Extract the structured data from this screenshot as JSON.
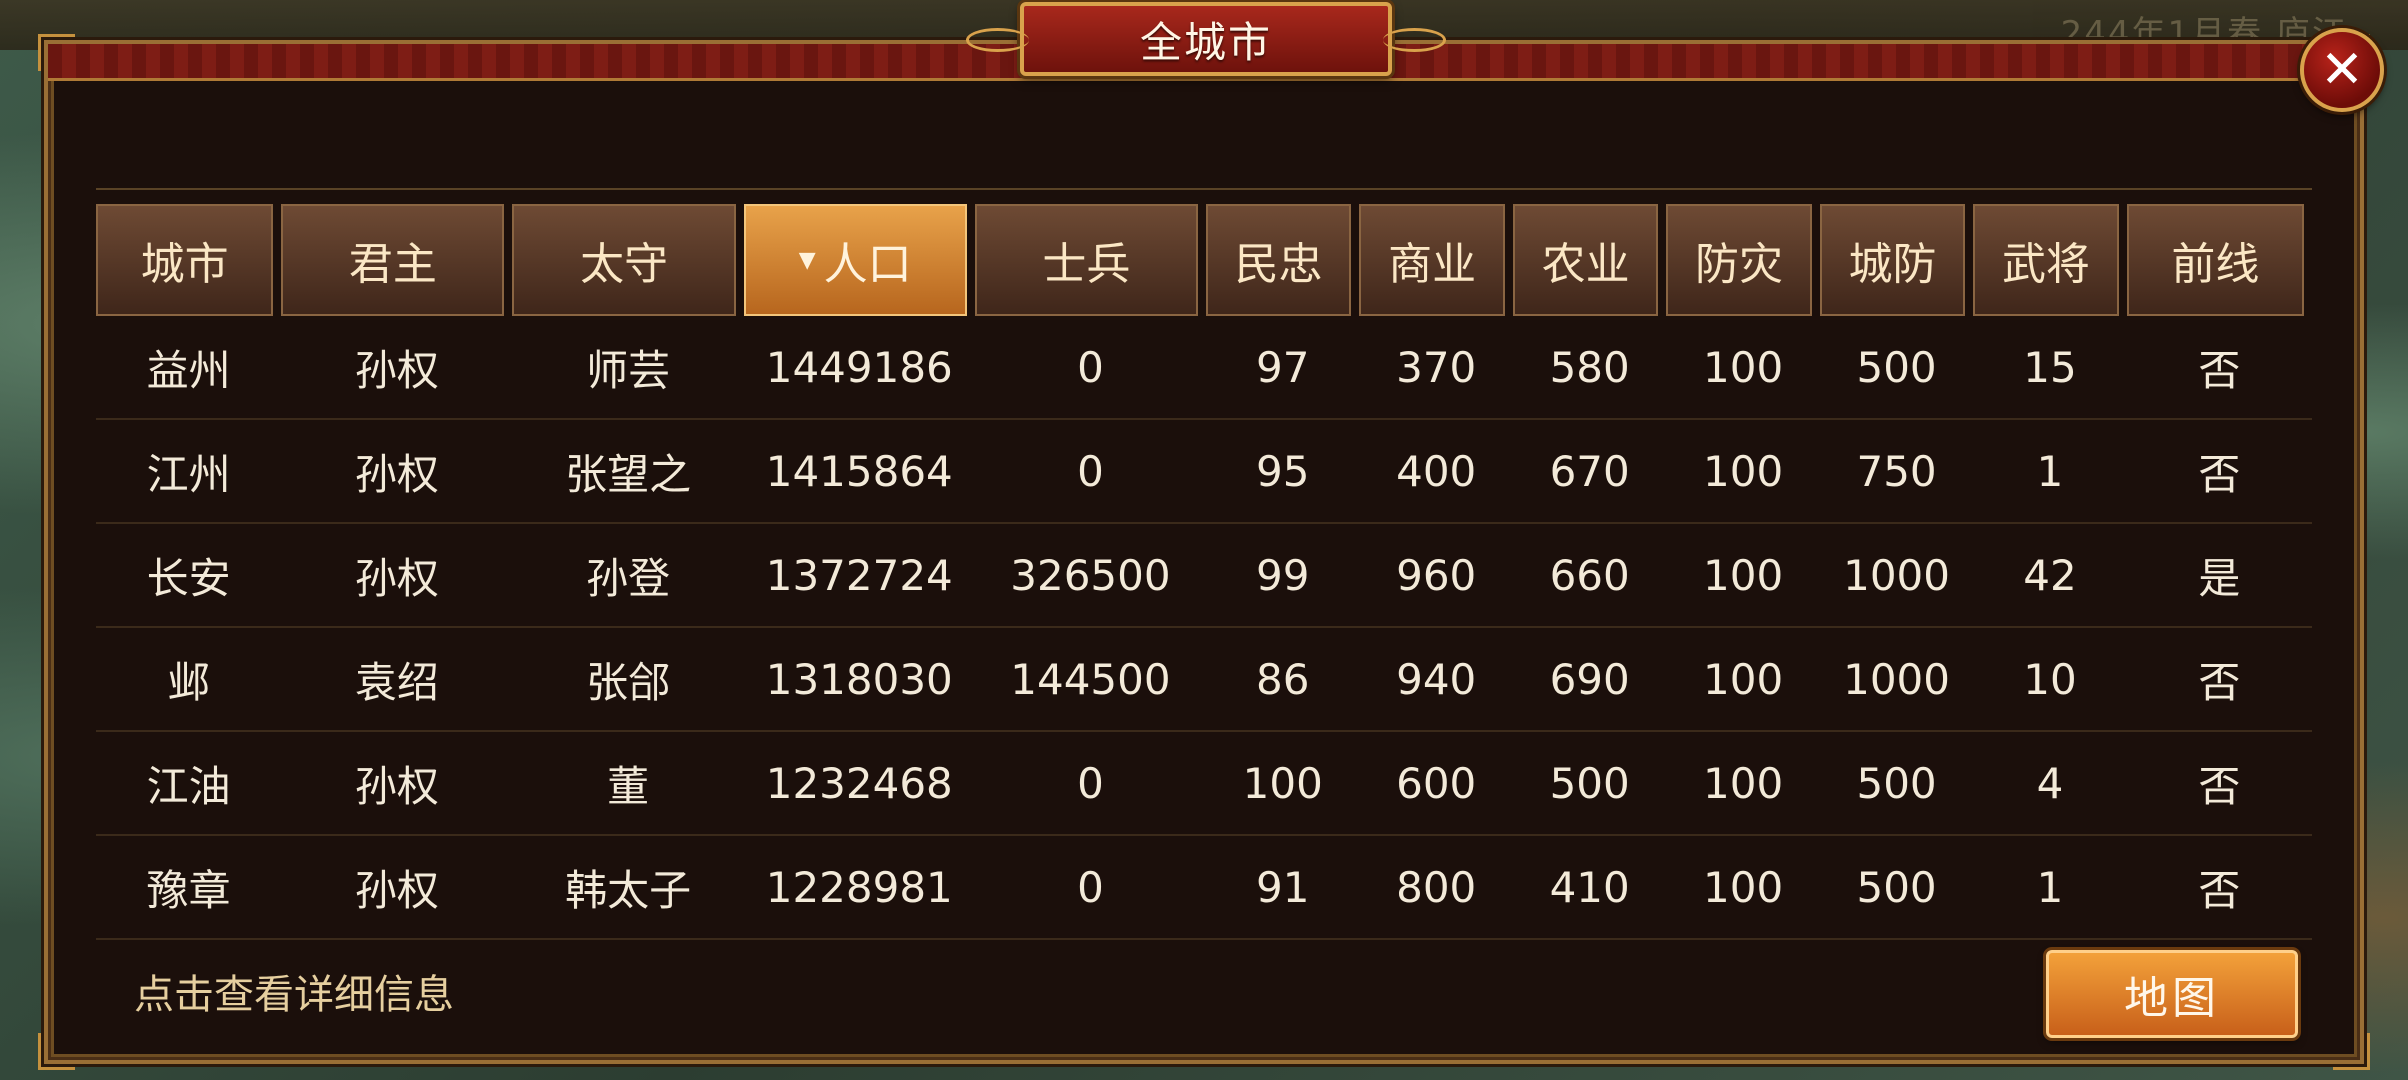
{
  "window": {
    "title": "全城市",
    "close_icon": "close-icon"
  },
  "background": {
    "top_right_text": "244年1月春 庐江"
  },
  "table": {
    "headers": [
      {
        "label": "城市",
        "sorted": false
      },
      {
        "label": "君主",
        "sorted": false
      },
      {
        "label": "太守",
        "sorted": false
      },
      {
        "label": "人口",
        "sorted": true,
        "sort_icon": "sort-down-icon"
      },
      {
        "label": "士兵",
        "sorted": false
      },
      {
        "label": "民忠",
        "sorted": false
      },
      {
        "label": "商业",
        "sorted": false
      },
      {
        "label": "农业",
        "sorted": false
      },
      {
        "label": "防灾",
        "sorted": false
      },
      {
        "label": "城防",
        "sorted": false
      },
      {
        "label": "武将",
        "sorted": false
      },
      {
        "label": "前线",
        "sorted": false
      }
    ],
    "rows": [
      [
        "益州",
        "孙权",
        "师芸",
        "1449186",
        "0",
        "97",
        "370",
        "580",
        "100",
        "500",
        "15",
        "否"
      ],
      [
        "江州",
        "孙权",
        "张望之",
        "1415864",
        "0",
        "95",
        "400",
        "670",
        "100",
        "750",
        "1",
        "否"
      ],
      [
        "长安",
        "孙权",
        "孙登",
        "1372724",
        "326500",
        "99",
        "960",
        "660",
        "100",
        "1000",
        "42",
        "是"
      ],
      [
        "邺",
        "袁绍",
        "张郃",
        "1318030",
        "144500",
        "86",
        "940",
        "690",
        "100",
        "1000",
        "10",
        "否"
      ],
      [
        "江油",
        "孙权",
        "董",
        "1232468",
        "0",
        "100",
        "600",
        "500",
        "100",
        "500",
        "4",
        "否"
      ],
      [
        "豫章",
        "孙权",
        "韩太子",
        "1228981",
        "0",
        "91",
        "800",
        "410",
        "100",
        "500",
        "1",
        "否"
      ]
    ]
  },
  "footer": {
    "hint": "点击查看详细信息",
    "map_button": "地图"
  },
  "colors": {
    "panel_bg": "#1b0f0b",
    "gold_border": "#d9a24c",
    "active_header": "#e8a24a",
    "title_red": "#a8281c"
  }
}
